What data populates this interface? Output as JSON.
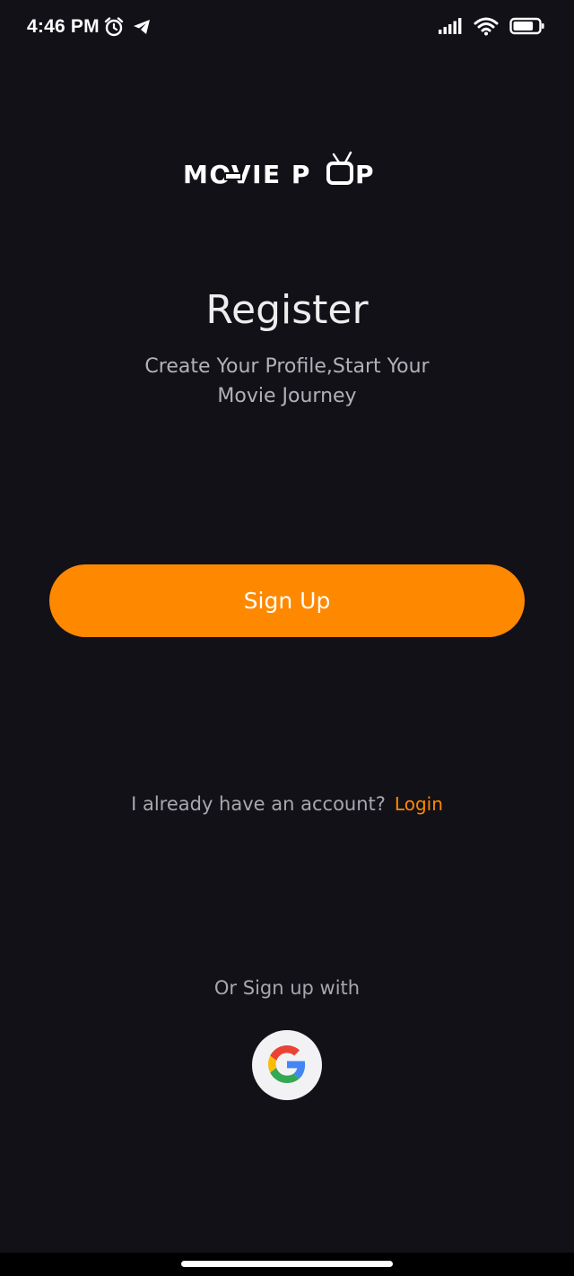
{
  "status_bar": {
    "time": "4:46 PM",
    "battery_level": 0.8
  },
  "logo": {
    "text": "MOVIE POP"
  },
  "register": {
    "title": "Register",
    "subtitle": "Create Your Profile,Start Your Movie Journey"
  },
  "signup_button": {
    "label": "Sign Up"
  },
  "login_row": {
    "prompt": "I already have an account?",
    "link": "Login"
  },
  "alt_signup": {
    "label": "Or Sign up with",
    "provider_icon": "google-icon"
  },
  "colors": {
    "background": "#131118",
    "accent": "#ff8801"
  }
}
